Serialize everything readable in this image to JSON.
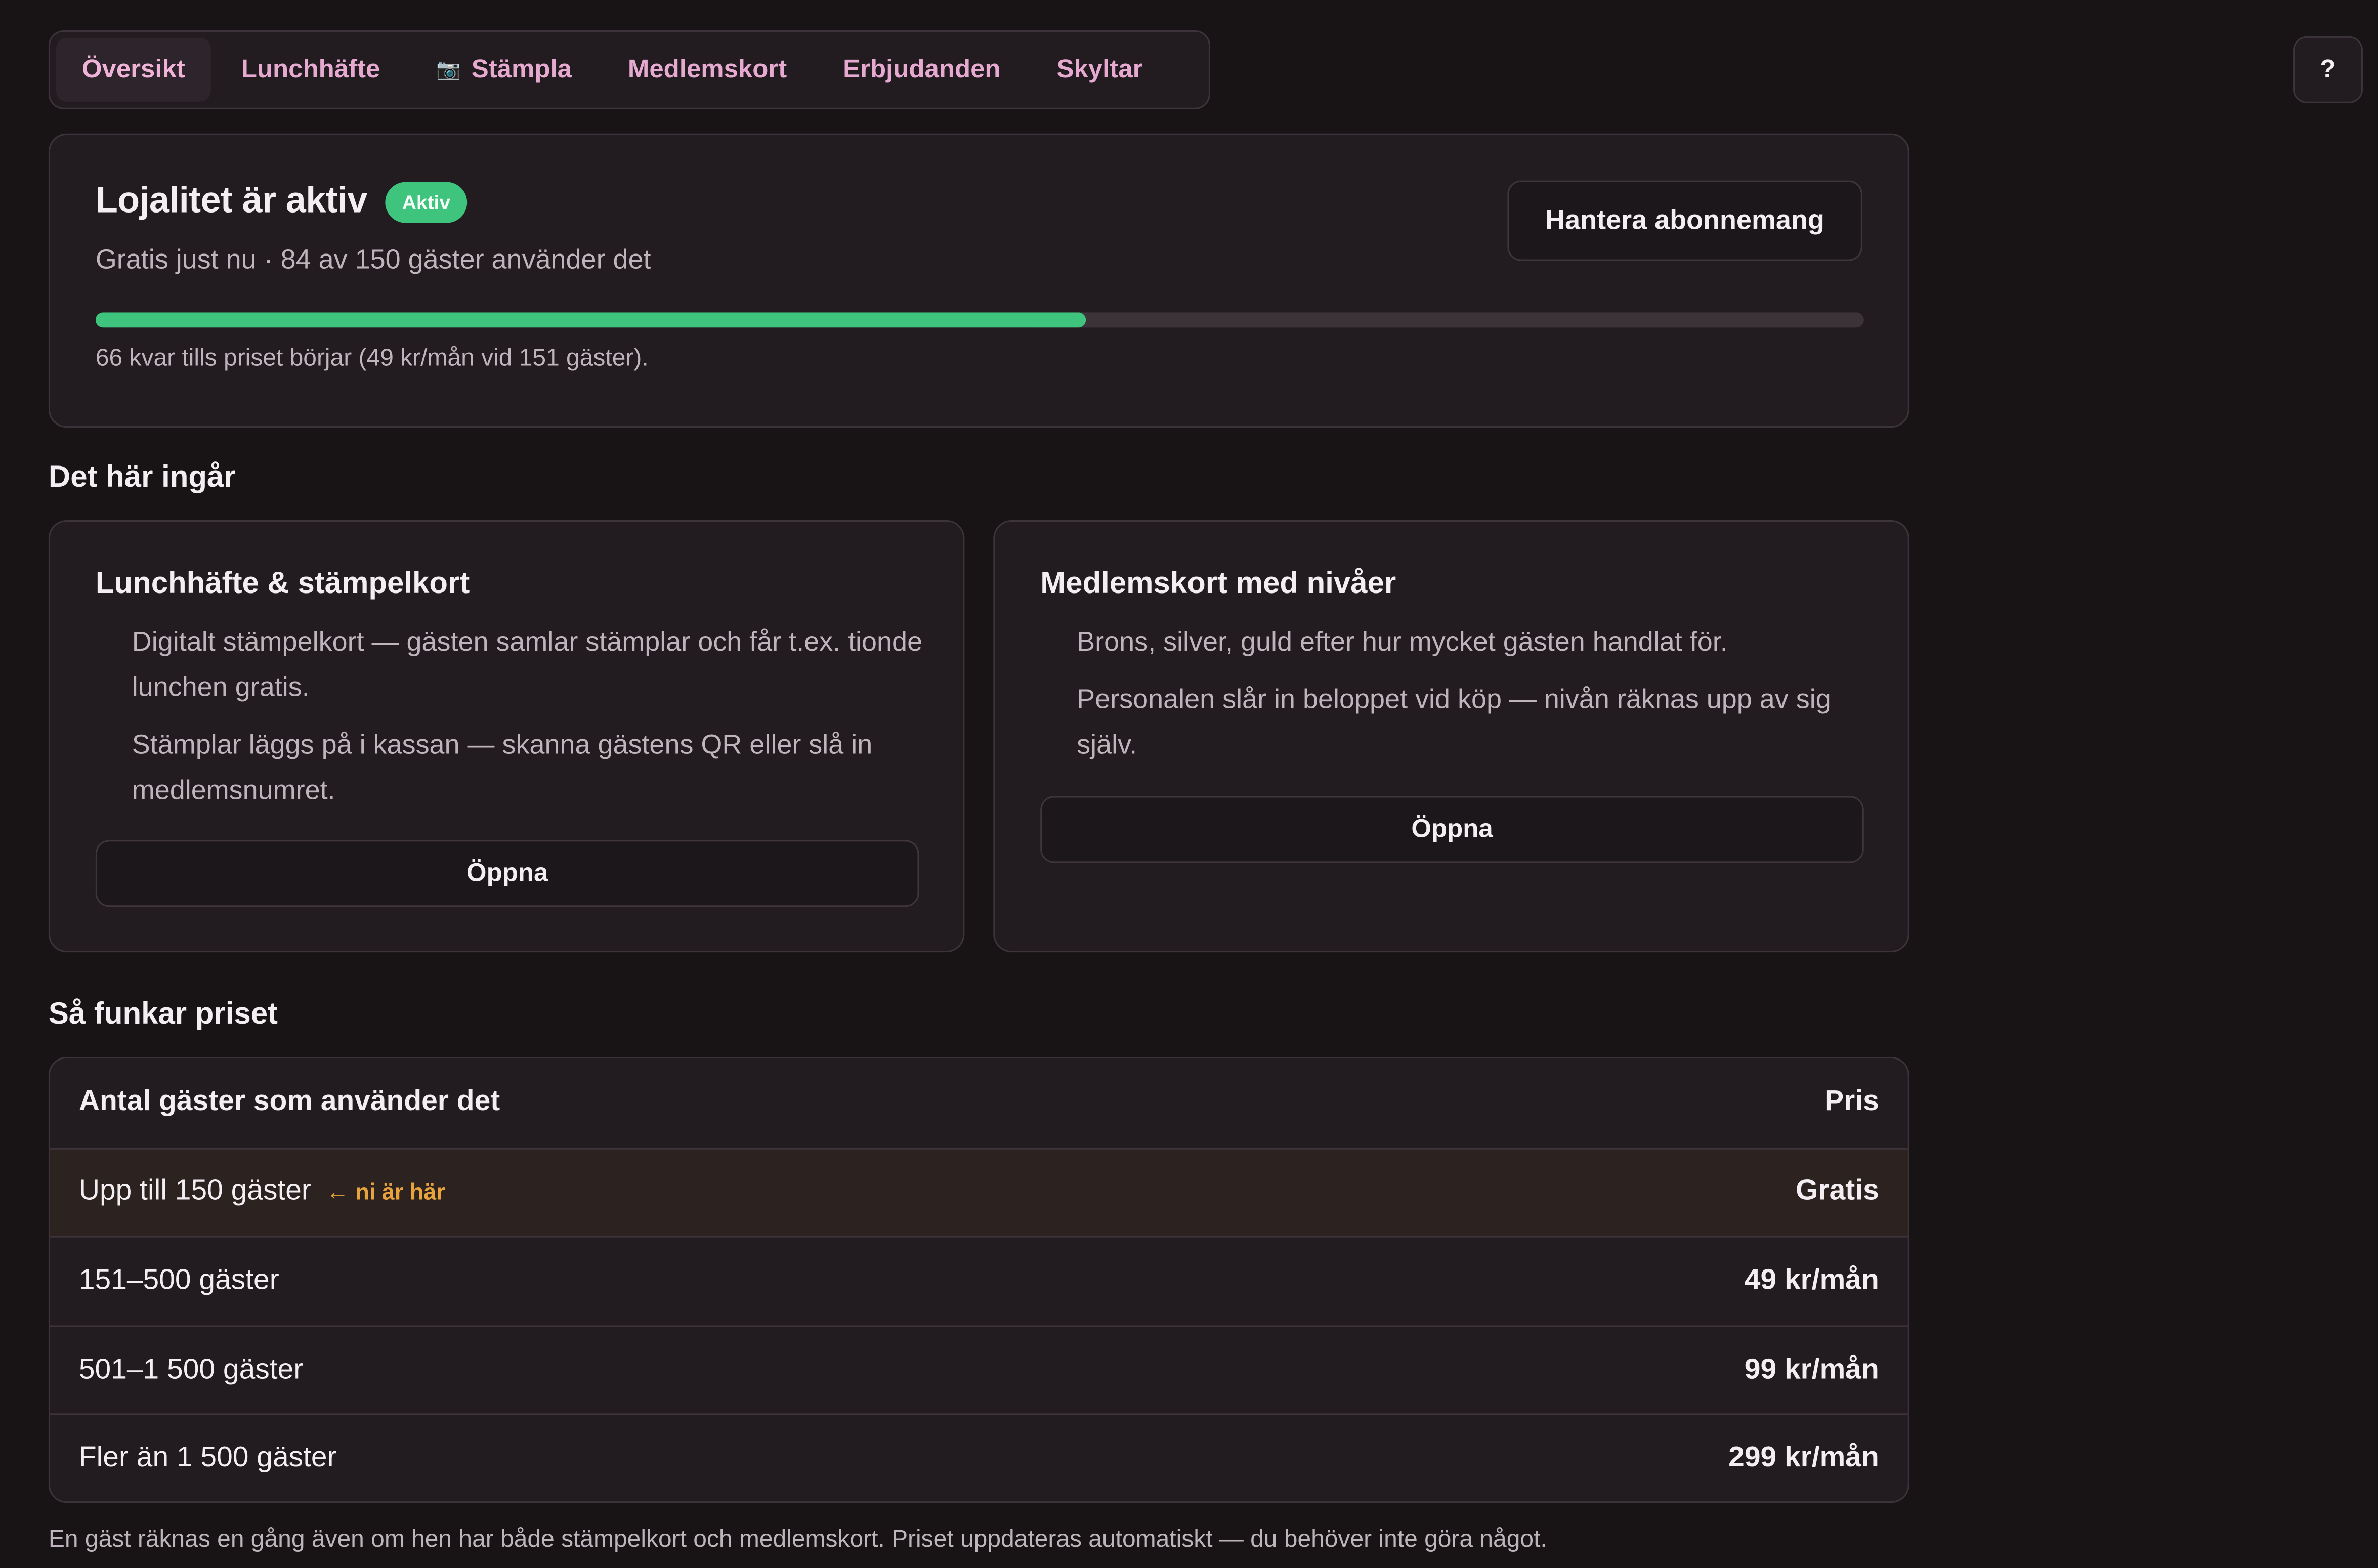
{
  "nav": {
    "tabs": [
      {
        "label": "Översikt",
        "active": true
      },
      {
        "label": "Lunchhäfte"
      },
      {
        "label": "Stämpla",
        "icon": "camera-icon",
        "icon_glyph": "📷"
      },
      {
        "label": "Medlemskort"
      },
      {
        "label": "Erbjudanden"
      },
      {
        "label": "Skyltar"
      }
    ],
    "help_label": "?"
  },
  "status": {
    "title": "Lojalitet är aktiv",
    "badge": "Aktiv",
    "subtitle": "Gratis just nu · 84 av 150 gäster använder det",
    "manage_button": "Hantera abonnemang",
    "progress_fraction": 0.56,
    "note": "66 kvar tills priset börjar (49 kr/mån vid 151 gäster)."
  },
  "included": {
    "heading": "Det här ingår",
    "cards": [
      {
        "title": "Lunchhäfte & stämpelkort",
        "lines": [
          "Digitalt stämpelkort — gästen samlar stämplar och får t.ex. tionde lunchen gratis.",
          "Stämplar läggs på i kassan — skanna gästens QR eller slå in medlemsnumret."
        ],
        "button": "Öppna"
      },
      {
        "title": "Medlemskort med nivåer",
        "lines": [
          "Brons, silver, guld efter hur mycket gästen handlat för.",
          "Personalen slår in beloppet vid köp — nivån räknas upp av sig själv."
        ],
        "button": "Öppna"
      }
    ]
  },
  "pricing": {
    "heading": "Så funkar priset",
    "columns": [
      "Antal gäster som använder det",
      "Pris"
    ],
    "rows": [
      {
        "guests": "Upp till 150 gäster",
        "price": "Gratis",
        "marker": "← ni är här",
        "current": true
      },
      {
        "guests": "151–500 gäster",
        "price": "49 kr/mån"
      },
      {
        "guests": "501–1 500 gäster",
        "price": "99 kr/mån"
      },
      {
        "guests": "Fler än 1 500 gäster",
        "price": "299 kr/mån"
      }
    ],
    "footnote": "En gäst räknas en gång även om hen har både stämpelkort och medlemskort. Priset uppdateras automatiskt — du behöver inte göra något."
  },
  "colors": {
    "accent_pink": "#e6a9d0",
    "success_green": "#3ec47c",
    "marker_orange": "#e9a33d",
    "background": "#181416"
  }
}
